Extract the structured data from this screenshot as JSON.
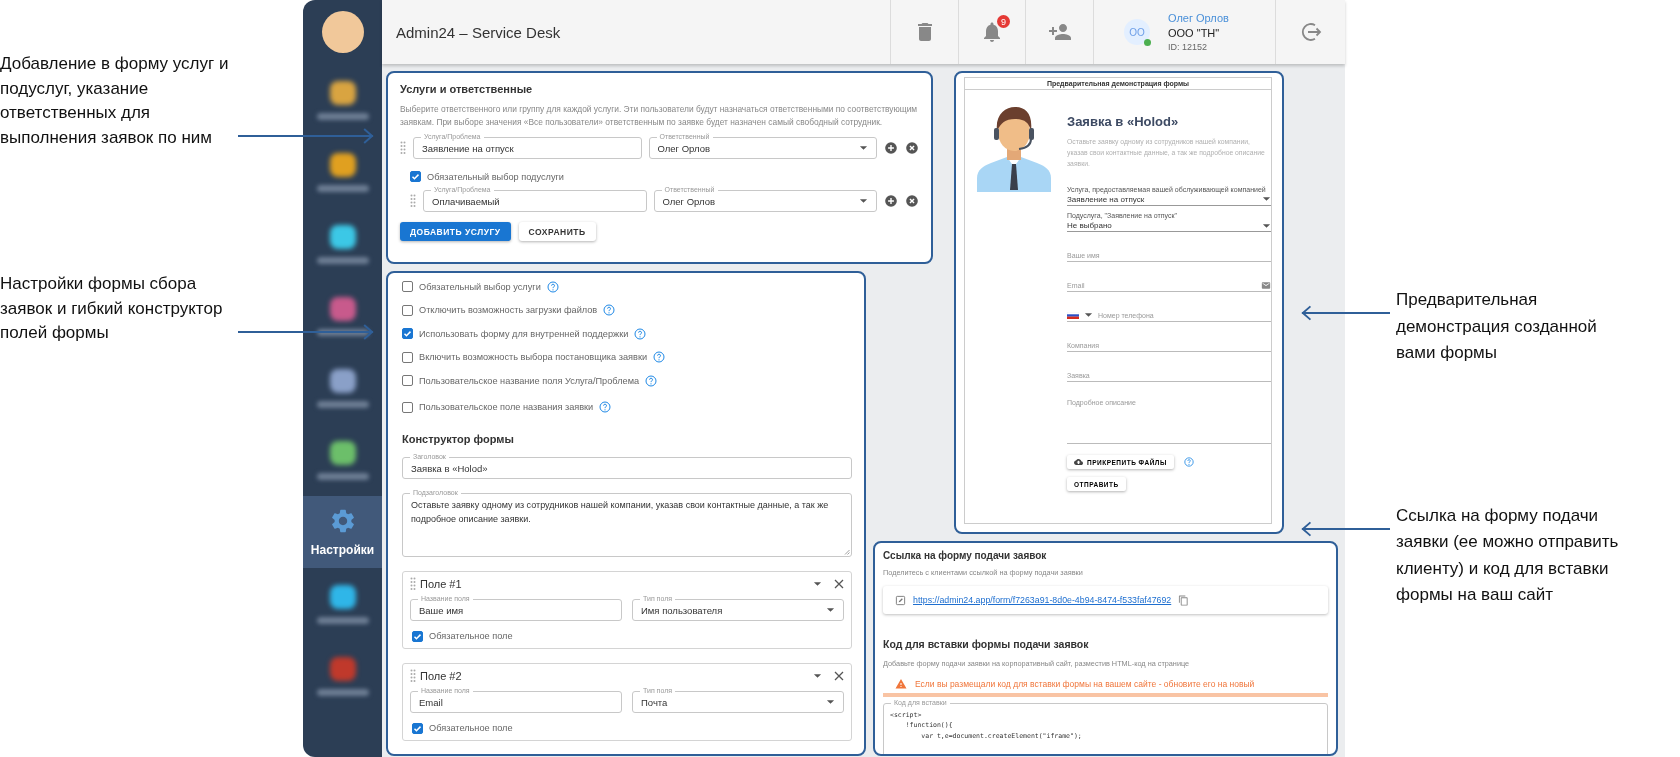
{
  "annotations_left": [
    {
      "text": "Добавление в форму услуг и подуслуг, указание ответственных для выполнения заявок по ним"
    },
    {
      "text": "Настройки формы сбора заявок и гибкий конструктор полей формы"
    }
  ],
  "annotations_right": [
    {
      "text": "Предварительная демонстрация созданной вами формы"
    },
    {
      "text": "Ссылка на форму подачи заявки (ее можно отправить клиенту) и код для вставки формы на ваш сайт"
    }
  ],
  "sidebar": {
    "items": [
      {
        "selected": false,
        "color": "#d9a441"
      },
      {
        "selected": false,
        "color": "#e0a020"
      },
      {
        "selected": false,
        "color": "#3cc8e6"
      },
      {
        "selected": false,
        "color": "#c85a8c"
      },
      {
        "selected": false,
        "color": "#8aa0c8"
      },
      {
        "selected": false,
        "color": "#6cbf6a"
      },
      {
        "label": "Настройки",
        "selected": true,
        "color": "#5b9bd5"
      },
      {
        "selected": false,
        "color": "#2fb6e8"
      },
      {
        "selected": false,
        "color": "#c0392b"
      }
    ]
  },
  "header": {
    "title": "Admin24 – Service Desk",
    "notifications": "9",
    "user": {
      "initials": "OO",
      "name": "Олег Орлов",
      "company": "ООО \"ТН\"",
      "id": "ID: 12152",
      "online": true
    }
  },
  "services": {
    "title": "Услуги и ответственные",
    "description": "Выберите ответственного или группу для каждой услуги. Эти пользователи будут назначаться ответственными по соответствующим заявкам. При выборе значения «Все пользователи» ответственным по заявке будет назначен самый свободный сотрудник.",
    "rows": [
      {
        "service_label": "Услуга/Проблема",
        "service": "Заявление на отпуск",
        "assignee_label": "Ответственный",
        "assignee": "Олег Орлов"
      }
    ],
    "sub_required": {
      "label": "Обязательный выбор подуслуги",
      "checked": true
    },
    "sub_rows": [
      {
        "service_label": "Услуга/Проблема",
        "service": "Оплачиваемый",
        "assignee_label": "Ответственный",
        "assignee": "Олег Орлов"
      }
    ],
    "buttons": [
      {
        "label": "ДОБАВИТЬ УСЛУГУ",
        "kind": "primary"
      },
      {
        "label": "СОХРАНИТЬ",
        "kind": "secondary"
      }
    ]
  },
  "settings": {
    "options": [
      {
        "label": "Обязательный выбор услуги",
        "checked": false
      },
      {
        "label": "Отключить возможность загрузки файлов",
        "checked": false
      },
      {
        "label": "Использовать форму для внутренней поддержки",
        "checked": true
      },
      {
        "label": "Включить возможность выбора постановщика заявки",
        "checked": false
      },
      {
        "label": "Пользовательское название поля Услуга/Проблема",
        "checked": false
      },
      {
        "label": "Пользовательское поле названия заявки",
        "checked": false
      }
    ],
    "constructor_title": "Конструктор формы",
    "title_field": {
      "label": "Заголовок",
      "value": "Заявка в «Holod»"
    },
    "subtitle_field": {
      "label": "Подзаголовок",
      "value": "Оставьте заявку одному из сотрудников нашей компании, указав свои контактные данные, а так же подробное описание заявки."
    },
    "fields": [
      {
        "title": "Поле #1",
        "name_label": "Название поля",
        "name": "Ваше имя",
        "type_label": "Тип поля",
        "type": "Имя пользователя",
        "required_label": "Обязательное поле",
        "required": true
      },
      {
        "title": "Поле #2",
        "name_label": "Название поля",
        "name": "Email",
        "type_label": "Тип поля",
        "type": "Почта",
        "required_label": "Обязательное поле",
        "required": true
      }
    ]
  },
  "preview": {
    "header": "Предварительная демонстрация формы",
    "title": "Заявка в «Holod»",
    "description": "Оставьте заявку одному из сотрудников нашей компании, указав свои контактные данные, а так же подробное описание заявки.",
    "selects": [
      {
        "label": "Услуга, предоставляемая вашей обслуживающей компанией",
        "value": "Заявление на отпуск"
      },
      {
        "label": "Подуслуга, \"Заявление на отпуск\"",
        "value": "Не выбрано"
      }
    ],
    "inputs": [
      {
        "kind": "text",
        "placeholder": "Ваше имя"
      },
      {
        "kind": "email",
        "placeholder": "Email"
      },
      {
        "kind": "phone",
        "placeholder": "Номер телефона"
      },
      {
        "kind": "text",
        "placeholder": "Компания"
      },
      {
        "kind": "text",
        "placeholder": "Заявка"
      },
      {
        "kind": "textarea",
        "placeholder": "Подробное описание"
      }
    ],
    "attach_button": "ПРИКРЕПИТЬ ФАЙЛЫ",
    "submit_button": "ОТПРАВИТЬ"
  },
  "link": {
    "title": "Ссылка на форму подачи заявок",
    "description": "Поделитесь с клиентами ссылкой на форму подачи заявки",
    "url": "https://admin24.app/form/f7263a91-8d0e-4b94-8474-f533faf47692"
  },
  "embed": {
    "title": "Код для вставки формы подачи заявок",
    "description": "Добавьте форму подачи заявки на корпоративный сайт, разместив HTML-код на странице",
    "warning": "Если вы размещали код для вставки формы на вашем сайте - обновите его на новый",
    "code_label": "Код для вставки",
    "code": "<script>\n    !function(){\n        var t,e=document.createElement(\"iframe\");"
  }
}
